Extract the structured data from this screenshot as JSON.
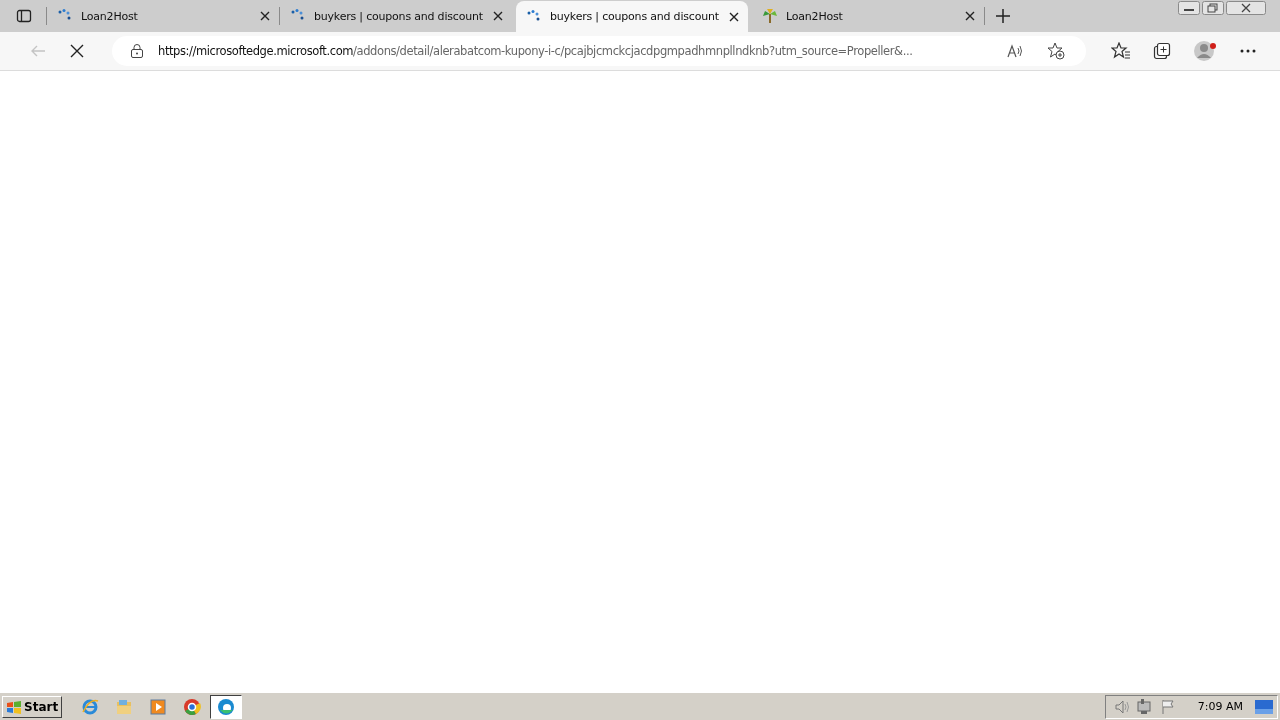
{
  "tabs": [
    {
      "title": "Loan2Host",
      "kind": "spinner",
      "selected": false
    },
    {
      "title": "buykers | coupons and discount",
      "kind": "spinner",
      "selected": false
    },
    {
      "title": "buykers | coupons and discount",
      "kind": "spinner",
      "selected": true
    },
    {
      "title": "Loan2Host",
      "kind": "palm",
      "selected": false
    }
  ],
  "address_bar": {
    "url_host": "https://microsoftedge.microsoft.com",
    "url_path": "/addons/detail/alerabatcom-kupony-i-c/pcajbjcmckcjacdpgmpadhmnpllndknb?utm_source=Propeller&..."
  },
  "taskbar": {
    "start_label": "Start",
    "apps": [
      {
        "kind": "ie",
        "selected": false
      },
      {
        "kind": "folder",
        "selected": false
      },
      {
        "kind": "media",
        "selected": false
      },
      {
        "kind": "chrome",
        "selected": false
      },
      {
        "kind": "edge",
        "selected": true
      }
    ],
    "clock": "7:09 AM"
  }
}
